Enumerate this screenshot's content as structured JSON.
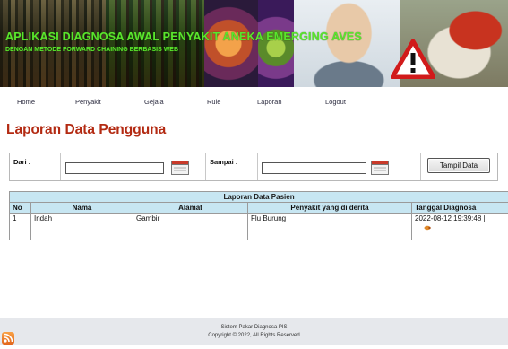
{
  "banner": {
    "title": "APLIKASI DIAGNOSA AWAL PENYAKIT ANEKA EMERGING AVES",
    "subtitle": "DENGAN METODE FORWARD CHAINING BERBASIS WEB"
  },
  "nav": {
    "home": "Home",
    "penyakit": "Penyakit",
    "gejala": "Gejala",
    "rule": "Rule",
    "laporan": "Laporan",
    "logout": "Logout"
  },
  "page": {
    "title": "Laporan Data Pengguna"
  },
  "filter": {
    "dari_label": "Dari :",
    "dari_value": "",
    "sampai_label": "Sampai :",
    "sampai_value": "",
    "button_label": "Tampil Data"
  },
  "report": {
    "caption": "Laporan Data Pasien",
    "columns": [
      "No",
      "Nama",
      "Alamat",
      "Penyakit yang di derita",
      "Tanggal Diagnosa"
    ],
    "rows": [
      {
        "no": "1",
        "nama": "Indah",
        "alamat": "Gambir",
        "penyakit": "Flu Burung",
        "tanggal": "2022-08-12 19:39:48 |"
      }
    ]
  },
  "footer": {
    "line1": "Sistem Pakar Diagnosa PIS",
    "line2": "Copyright © 2022, All Rights Reserved"
  },
  "colors": {
    "title": "#b32a12",
    "banner_text": "#5ae62c",
    "table_header": "#c7e6f2",
    "footer_bg": "#e6e8ec"
  }
}
